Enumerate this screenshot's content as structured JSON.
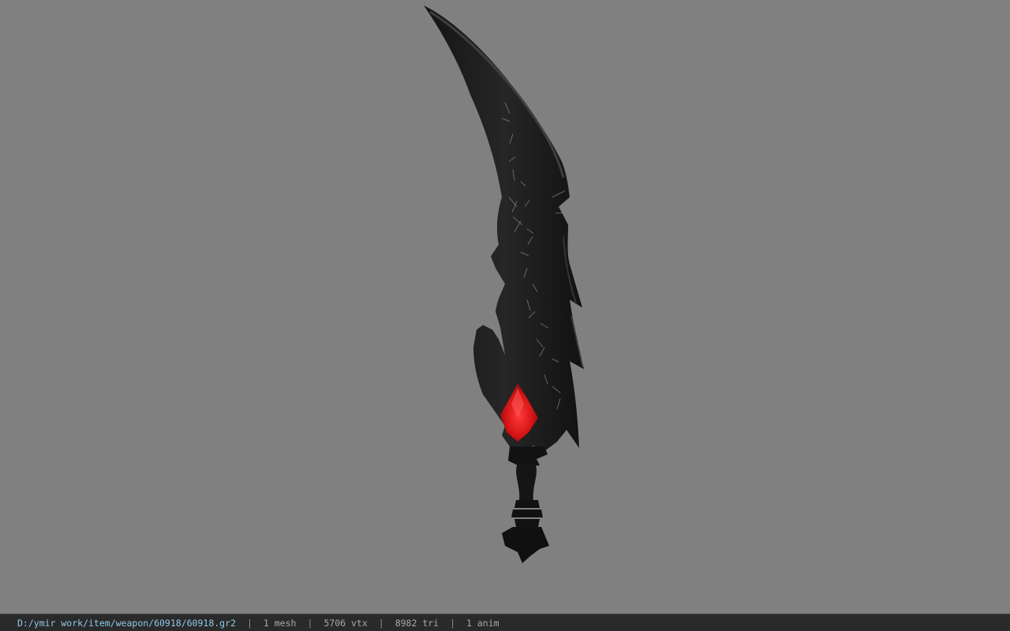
{
  "viewer": {
    "background_color": "#808080",
    "model_icon": "curved-sword-icon",
    "model_colors": {
      "blade": "#1a1a1a",
      "blade_highlight": "#3a3a3a",
      "gem": "#d81818",
      "etching": "#8a8a8a"
    }
  },
  "status": {
    "path": "D:/ymir work/item/weapon/60918/60918.gr2",
    "separator": "|",
    "mesh": "1 mesh",
    "vtx": "5706 vtx",
    "tri": "8982 tri",
    "anim": "1 anim"
  }
}
